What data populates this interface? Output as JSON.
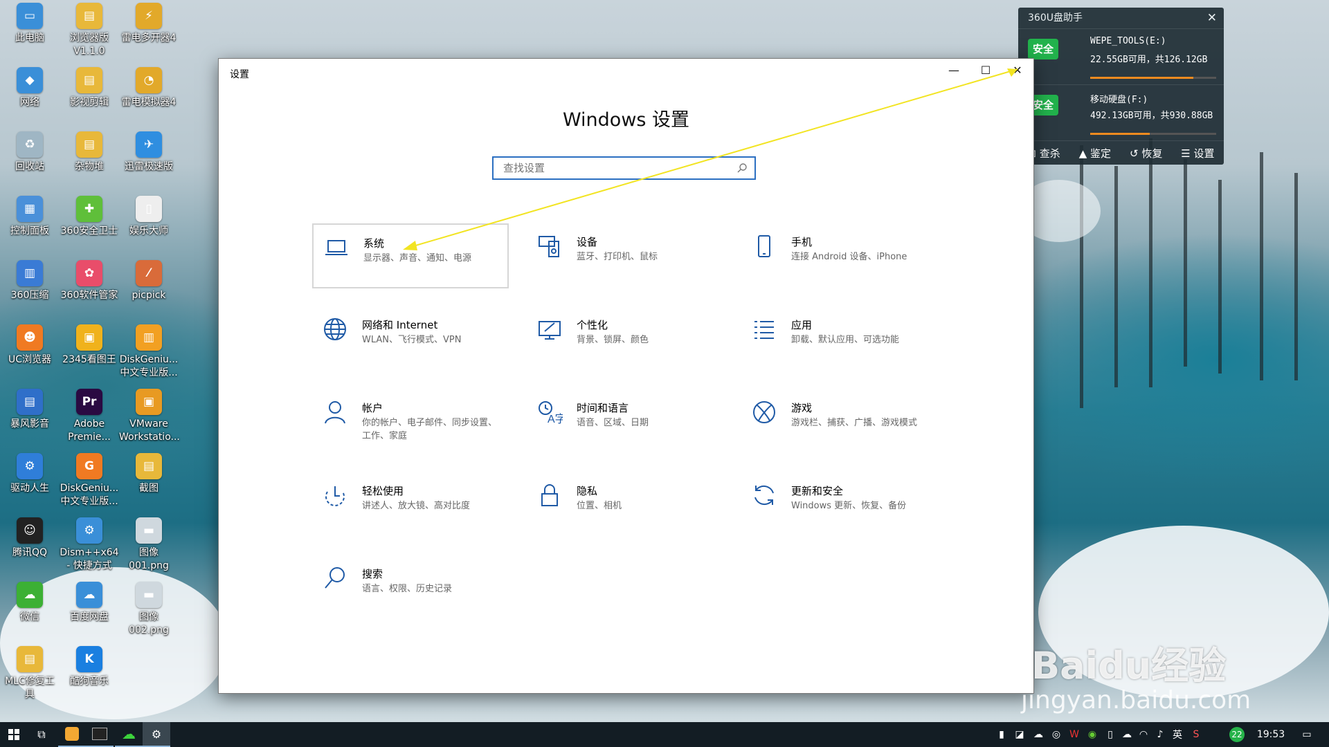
{
  "desktop_icons": [
    {
      "label": "此电脑",
      "color": "#3a8fd8",
      "glyph": "▭"
    },
    {
      "label": "浏览器版\nV1.1.0",
      "color": "#e8b83a",
      "glyph": "▤"
    },
    {
      "label": "雷电多开器4",
      "color": "#e2a92a",
      "glyph": "⚡"
    },
    {
      "label": "网络",
      "color": "#3a8fd8",
      "glyph": "◆"
    },
    {
      "label": "影视剪辑",
      "color": "#e8b83a",
      "glyph": "▤"
    },
    {
      "label": "雷电模拟器4",
      "color": "#e2a92a",
      "glyph": "◔"
    },
    {
      "label": "回收站",
      "color": "#9fb6c4",
      "glyph": "♻"
    },
    {
      "label": "杂物堆",
      "color": "#e8b83a",
      "glyph": "▤"
    },
    {
      "label": "迅雷极速版",
      "color": "#2f8ee0",
      "glyph": "✈"
    },
    {
      "label": "控制面板",
      "color": "#4a90d9",
      "glyph": "▦"
    },
    {
      "label": "360安全卫士",
      "color": "#5fbf3a",
      "glyph": "✚"
    },
    {
      "label": "娱乐大师",
      "color": "#eeeeee",
      "glyph": "▯"
    },
    {
      "label": "360压缩",
      "color": "#3a7bd5",
      "glyph": "▥"
    },
    {
      "label": "360软件管家",
      "color": "#e94d6a",
      "glyph": "✿"
    },
    {
      "label": "picpick",
      "color": "#d96b3a",
      "glyph": "⁄"
    },
    {
      "label": "UC浏览器",
      "color": "#f07a22",
      "glyph": "☻"
    },
    {
      "label": "2345看图王",
      "color": "#f0b21c",
      "glyph": "▣"
    },
    {
      "label": "DiskGeniu...\n中文专业版...",
      "color": "#f2a022",
      "glyph": "▥"
    },
    {
      "label": "暴风影音",
      "color": "#2f6fc9",
      "glyph": "▤"
    },
    {
      "label": "Adobe\nPremie...",
      "color": "#2a0a42",
      "glyph": "Pr"
    },
    {
      "label": "VMware\nWorkstatio...",
      "color": "#e89a22",
      "glyph": "▣"
    },
    {
      "label": "驱动人生",
      "color": "#2f7ed9",
      "glyph": "⚙"
    },
    {
      "label": "DiskGeniu...\n中文专业版...",
      "color": "#f07a22",
      "glyph": "G"
    },
    {
      "label": "截图",
      "color": "#e8b83a",
      "glyph": "▤"
    },
    {
      "label": "腾讯QQ",
      "color": "#222222",
      "glyph": "☺"
    },
    {
      "label": "Dism++x64\n- 快捷方式",
      "color": "#3a8fd8",
      "glyph": "⚙"
    },
    {
      "label": "图像\n001.png",
      "color": "#cfd8de",
      "glyph": "▬"
    },
    {
      "label": "微信",
      "color": "#3cb034",
      "glyph": "☁"
    },
    {
      "label": "百度网盘",
      "color": "#3a8fd8",
      "glyph": "☁"
    },
    {
      "label": "图像\n002.png",
      "color": "#cfd8de",
      "glyph": "▬"
    },
    {
      "label": "MLC修复工\n具",
      "color": "#e8b83a",
      "glyph": "▤"
    },
    {
      "label": "酷狗音乐",
      "color": "#1a7fe0",
      "glyph": "K"
    }
  ],
  "window": {
    "title": "设置",
    "heading": "Windows 设置",
    "search_placeholder": "查找设置",
    "minimize": "—",
    "maximize": "☐",
    "close": "✕"
  },
  "tiles": [
    {
      "name": "系统",
      "desc": "显示器、声音、通知、电源",
      "icon": "laptop-icon"
    },
    {
      "name": "设备",
      "desc": "蓝牙、打印机、鼠标",
      "icon": "devices-icon"
    },
    {
      "name": "手机",
      "desc": "连接 Android 设备、iPhone",
      "icon": "phone-icon"
    },
    {
      "name": "网络和 Internet",
      "desc": "WLAN、飞行模式、VPN",
      "icon": "globe-icon"
    },
    {
      "name": "个性化",
      "desc": "背景、锁屏、颜色",
      "icon": "paint-icon"
    },
    {
      "name": "应用",
      "desc": "卸载、默认应用、可选功能",
      "icon": "apps-list-icon"
    },
    {
      "name": "帐户",
      "desc": "你的帐户、电子邮件、同步设置、工作、家庭",
      "icon": "person-icon"
    },
    {
      "name": "时间和语言",
      "desc": "语音、区域、日期",
      "icon": "time-language-icon"
    },
    {
      "name": "游戏",
      "desc": "游戏栏、捕获、广播、游戏模式",
      "icon": "xbox-icon"
    },
    {
      "name": "轻松使用",
      "desc": "讲述人、放大镜、高对比度",
      "icon": "ease-of-access-icon"
    },
    {
      "name": "隐私",
      "desc": "位置、相机",
      "icon": "lock-icon"
    },
    {
      "name": "更新和安全",
      "desc": "Windows 更新、恢复、备份",
      "icon": "update-icon"
    },
    {
      "name": "搜索",
      "desc": "语言、权限、历史记录",
      "icon": "search-icon"
    }
  ],
  "usb_widget": {
    "title": "360U盘助手",
    "close": "✕",
    "drives": [
      {
        "badge": "安全",
        "name": "WEPE_TOOLS(E:)",
        "info": "22.55GB可用，共126.12GB",
        "used_fraction": 0.82
      },
      {
        "badge": "安全",
        "name": "移动硬盘(F:)",
        "info": "492.13GB可用，共930.88GB",
        "used_fraction": 0.47
      }
    ],
    "tools": [
      "查杀",
      "鉴定",
      "恢复",
      "设置"
    ]
  },
  "taskbar": {
    "clock": "19:53",
    "ime": "英",
    "badge_count": "22"
  },
  "watermark": {
    "logo": "Baidu经验",
    "url": "jingyan.baidu.com"
  }
}
